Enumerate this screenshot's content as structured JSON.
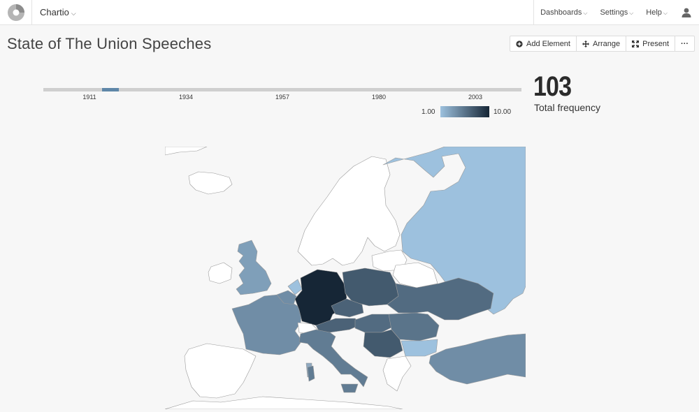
{
  "header": {
    "app_name": "Chartio",
    "nav": [
      {
        "label": "Dashboards"
      },
      {
        "label": "Settings"
      },
      {
        "label": "Help"
      }
    ]
  },
  "page": {
    "title": "State of The Union Speeches"
  },
  "toolbar": {
    "add_element": "Add Element",
    "arrange": "Arrange",
    "present": "Present",
    "more": "···"
  },
  "timeline": {
    "ticks": [
      "1911",
      "1934",
      "1957",
      "1980",
      "2003"
    ],
    "selected_range": [
      1914,
      1918
    ]
  },
  "legend": {
    "min": "1.00",
    "max": "10.00",
    "min_color": "#9dc1de",
    "max_color": "#162636"
  },
  "stat": {
    "value": "103",
    "label": "Total frequency"
  },
  "chart_data": {
    "type": "choropleth",
    "region": "Europe",
    "scale": {
      "min": 1.0,
      "max": 10.0
    },
    "regions": [
      {
        "country": "Germany",
        "value": 10.0
      },
      {
        "country": "Poland",
        "value": 7.0
      },
      {
        "country": "Ukraine",
        "value": 6.0
      },
      {
        "country": "Austria",
        "value": 6.5
      },
      {
        "country": "Czech Republic",
        "value": 6.5
      },
      {
        "country": "Hungary",
        "value": 6.0
      },
      {
        "country": "Romania",
        "value": 5.5
      },
      {
        "country": "Serbia",
        "value": 7.0
      },
      {
        "country": "Italy",
        "value": 5.0
      },
      {
        "country": "France",
        "value": 4.0
      },
      {
        "country": "United Kingdom",
        "value": 3.0
      },
      {
        "country": "Turkey",
        "value": 4.0
      },
      {
        "country": "Russia",
        "value": 1.0
      },
      {
        "country": "Bulgaria",
        "value": 1.0
      },
      {
        "country": "Netherlands",
        "value": 1.0
      },
      {
        "country": "Belgium",
        "value": 4.0
      }
    ]
  }
}
